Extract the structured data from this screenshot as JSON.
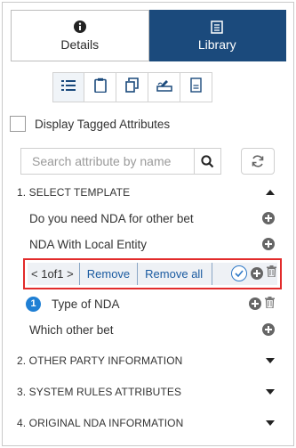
{
  "tabs": [
    {
      "label": "Details",
      "icon": "info-icon",
      "active": false
    },
    {
      "label": "Library",
      "icon": "library-icon",
      "active": true
    }
  ],
  "toolbar": {
    "icons": [
      "list-view-icon",
      "clipboard-icon",
      "copy-icon",
      "sign-icon",
      "document-icon"
    ]
  },
  "display_tagged": {
    "label": "Display Tagged Attributes",
    "checked": false
  },
  "search": {
    "placeholder": "Search attribute by name",
    "value": ""
  },
  "sections": [
    {
      "title": "1. SELECT TEMPLATE",
      "expanded": true,
      "items": [
        {
          "label": "Do you need NDA for other bet"
        },
        {
          "label": "NDA With Local Entity"
        },
        {
          "label": "Type of NDA",
          "badge": "1"
        },
        {
          "label": "Which other bet"
        }
      ]
    },
    {
      "title": "2. OTHER PARTY INFORMATION",
      "expanded": false
    },
    {
      "title": "3. SYSTEM RULES ATTRIBUTES",
      "expanded": false
    },
    {
      "title": "4. ORIGINAL NDA INFORMATION",
      "expanded": false
    }
  ],
  "match_bar": {
    "prev": "<",
    "counter": "1of1",
    "next": ">",
    "remove_label": "Remove",
    "remove_all_label": "Remove all"
  },
  "colors": {
    "accent": "#1b4a7c",
    "link": "#1a5aa0",
    "highlight_border": "#e22b2b",
    "badge": "#1f7fd4"
  }
}
